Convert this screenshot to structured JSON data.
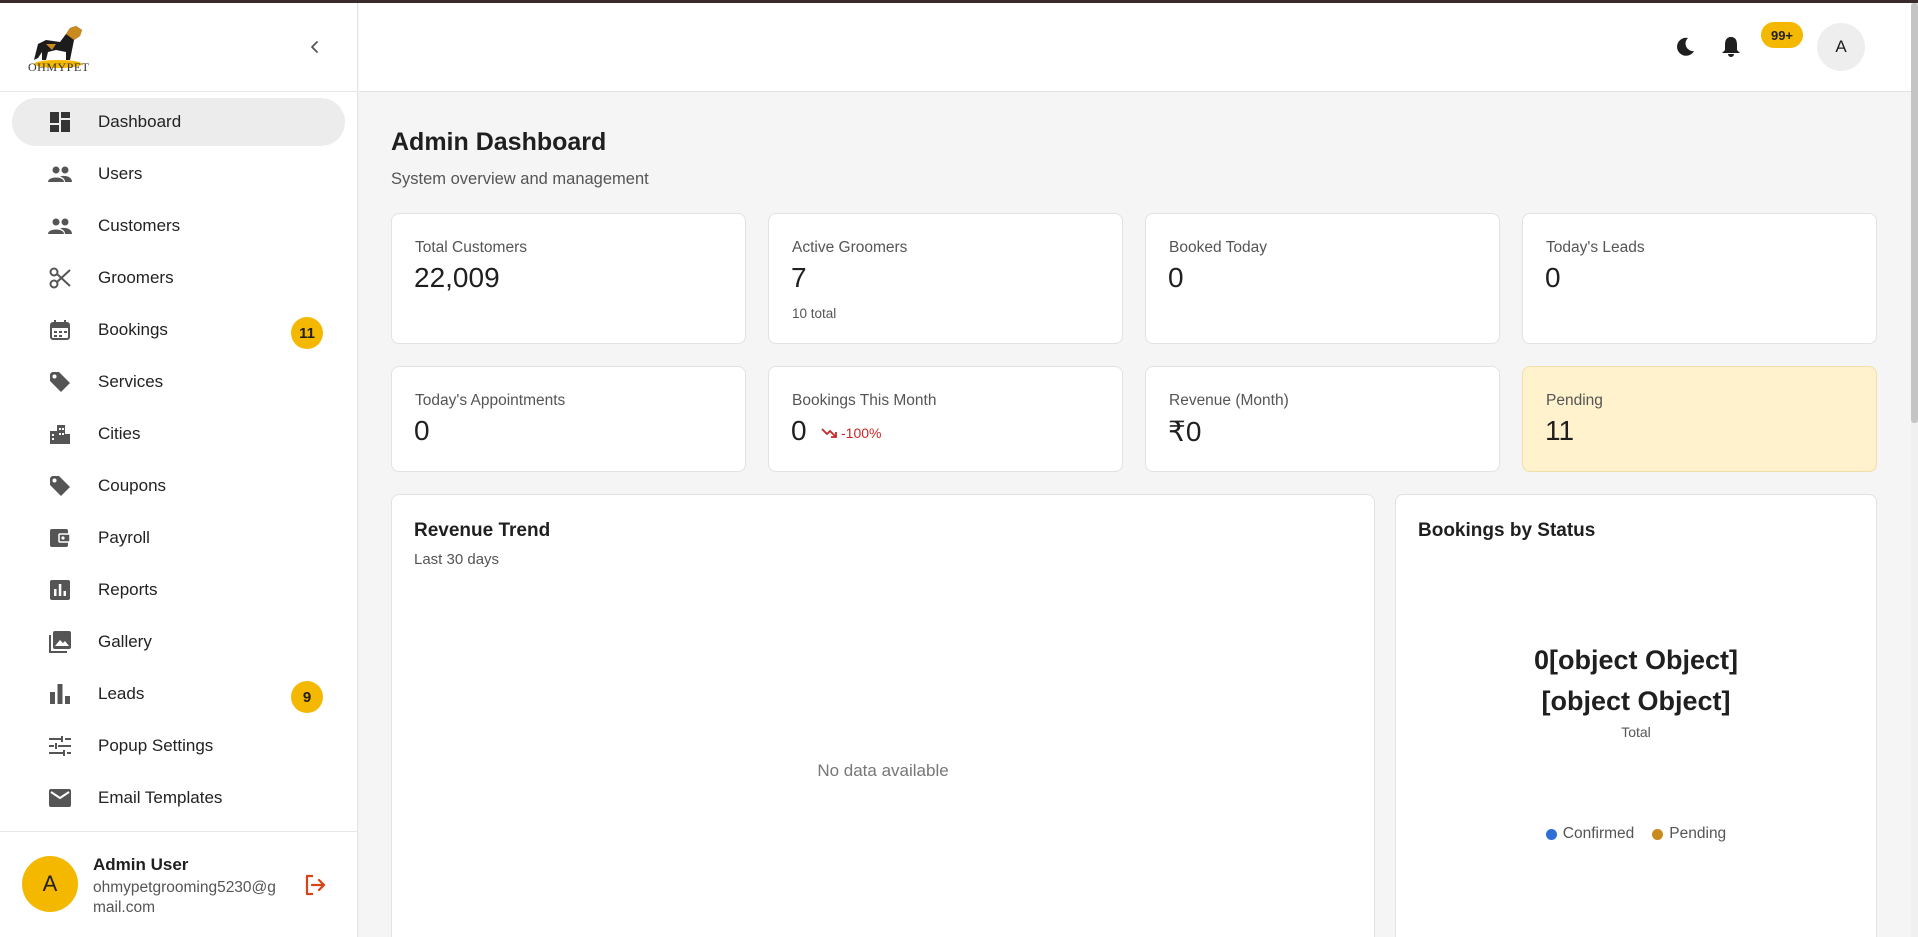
{
  "brand": {
    "logo_text": "OHMYPET"
  },
  "sidebar": {
    "items": [
      {
        "label": "Dashboard",
        "icon": "dashboard-icon",
        "active": true
      },
      {
        "label": "Users",
        "icon": "users-icon"
      },
      {
        "label": "Customers",
        "icon": "customers-icon"
      },
      {
        "label": "Groomers",
        "icon": "scissors-icon"
      },
      {
        "label": "Bookings",
        "icon": "calendar-icon",
        "badge": "11"
      },
      {
        "label": "Services",
        "icon": "tag-icon"
      },
      {
        "label": "Cities",
        "icon": "city-icon"
      },
      {
        "label": "Coupons",
        "icon": "tag-icon"
      },
      {
        "label": "Payroll",
        "icon": "wallet-icon"
      },
      {
        "label": "Reports",
        "icon": "chart-icon"
      },
      {
        "label": "Gallery",
        "icon": "gallery-icon"
      },
      {
        "label": "Leads",
        "icon": "bar-chart-icon",
        "badge": "9"
      },
      {
        "label": "Popup Settings",
        "icon": "sliders-icon"
      },
      {
        "label": "Email Templates",
        "icon": "mail-icon"
      }
    ],
    "user": {
      "initial": "A",
      "name": "Admin User",
      "email": "ohmypetgrooming5230@gmail.com"
    }
  },
  "header": {
    "notification_count": "99+",
    "avatar_initial": "A"
  },
  "main": {
    "title": "Admin Dashboard",
    "subtitle": "System overview and management",
    "stats": [
      {
        "label": "Total Customers",
        "value": "22,009"
      },
      {
        "label": "Active Groomers",
        "value": "7",
        "sub": "10 total"
      },
      {
        "label": "Booked Today",
        "value": "0"
      },
      {
        "label": "Today's Leads",
        "value": "0"
      },
      {
        "label": "Today's Appointments",
        "value": "0"
      },
      {
        "label": "Bookings This Month",
        "value": "0",
        "trend": "-100%"
      },
      {
        "label": "Revenue (Month)",
        "value": "₹0"
      },
      {
        "label": "Pending",
        "value": "11"
      }
    ],
    "revenue_panel": {
      "title": "Revenue Trend",
      "subtitle": "Last 30 days",
      "empty_text": "No data available"
    },
    "status_panel": {
      "title": "Bookings by Status",
      "total_text": "0[object Object][object Object]",
      "total_caption": "Total",
      "legend": [
        {
          "label": "Confirmed",
          "color": "#2e6fd6"
        },
        {
          "label": "Pending",
          "color": "#c98a1e"
        }
      ]
    }
  },
  "colors": {
    "accent": "#f5b800",
    "pending_card": "#fff2cc",
    "trend_down": "#c62828",
    "logout": "#d84315"
  }
}
